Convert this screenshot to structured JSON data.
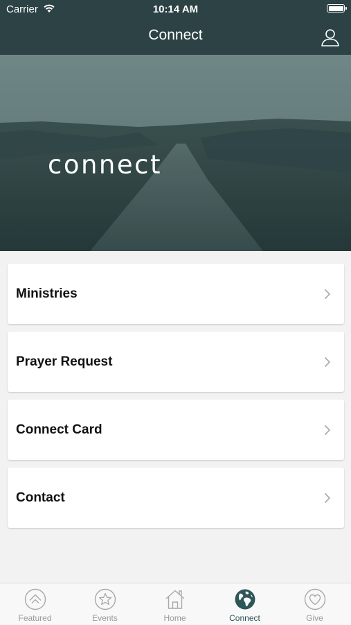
{
  "status_bar": {
    "carrier": "Carrier",
    "time": "10:14 AM"
  },
  "nav": {
    "title": "Connect"
  },
  "hero": {
    "text": "connect"
  },
  "menu": [
    {
      "label": "Ministries"
    },
    {
      "label": "Prayer Request"
    },
    {
      "label": "Connect Card"
    },
    {
      "label": "Contact"
    }
  ],
  "tabs": [
    {
      "label": "Featured",
      "icon": "chevron-up-circle-icon"
    },
    {
      "label": "Events",
      "icon": "star-circle-icon"
    },
    {
      "label": "Home",
      "icon": "house-icon"
    },
    {
      "label": "Connect",
      "icon": "globe-icon",
      "active": true
    },
    {
      "label": "Give",
      "icon": "heart-circle-icon"
    }
  ],
  "colors": {
    "nav_bg": "#2c4244",
    "accent": "#2e5558",
    "inactive": "#9a9a9a"
  }
}
